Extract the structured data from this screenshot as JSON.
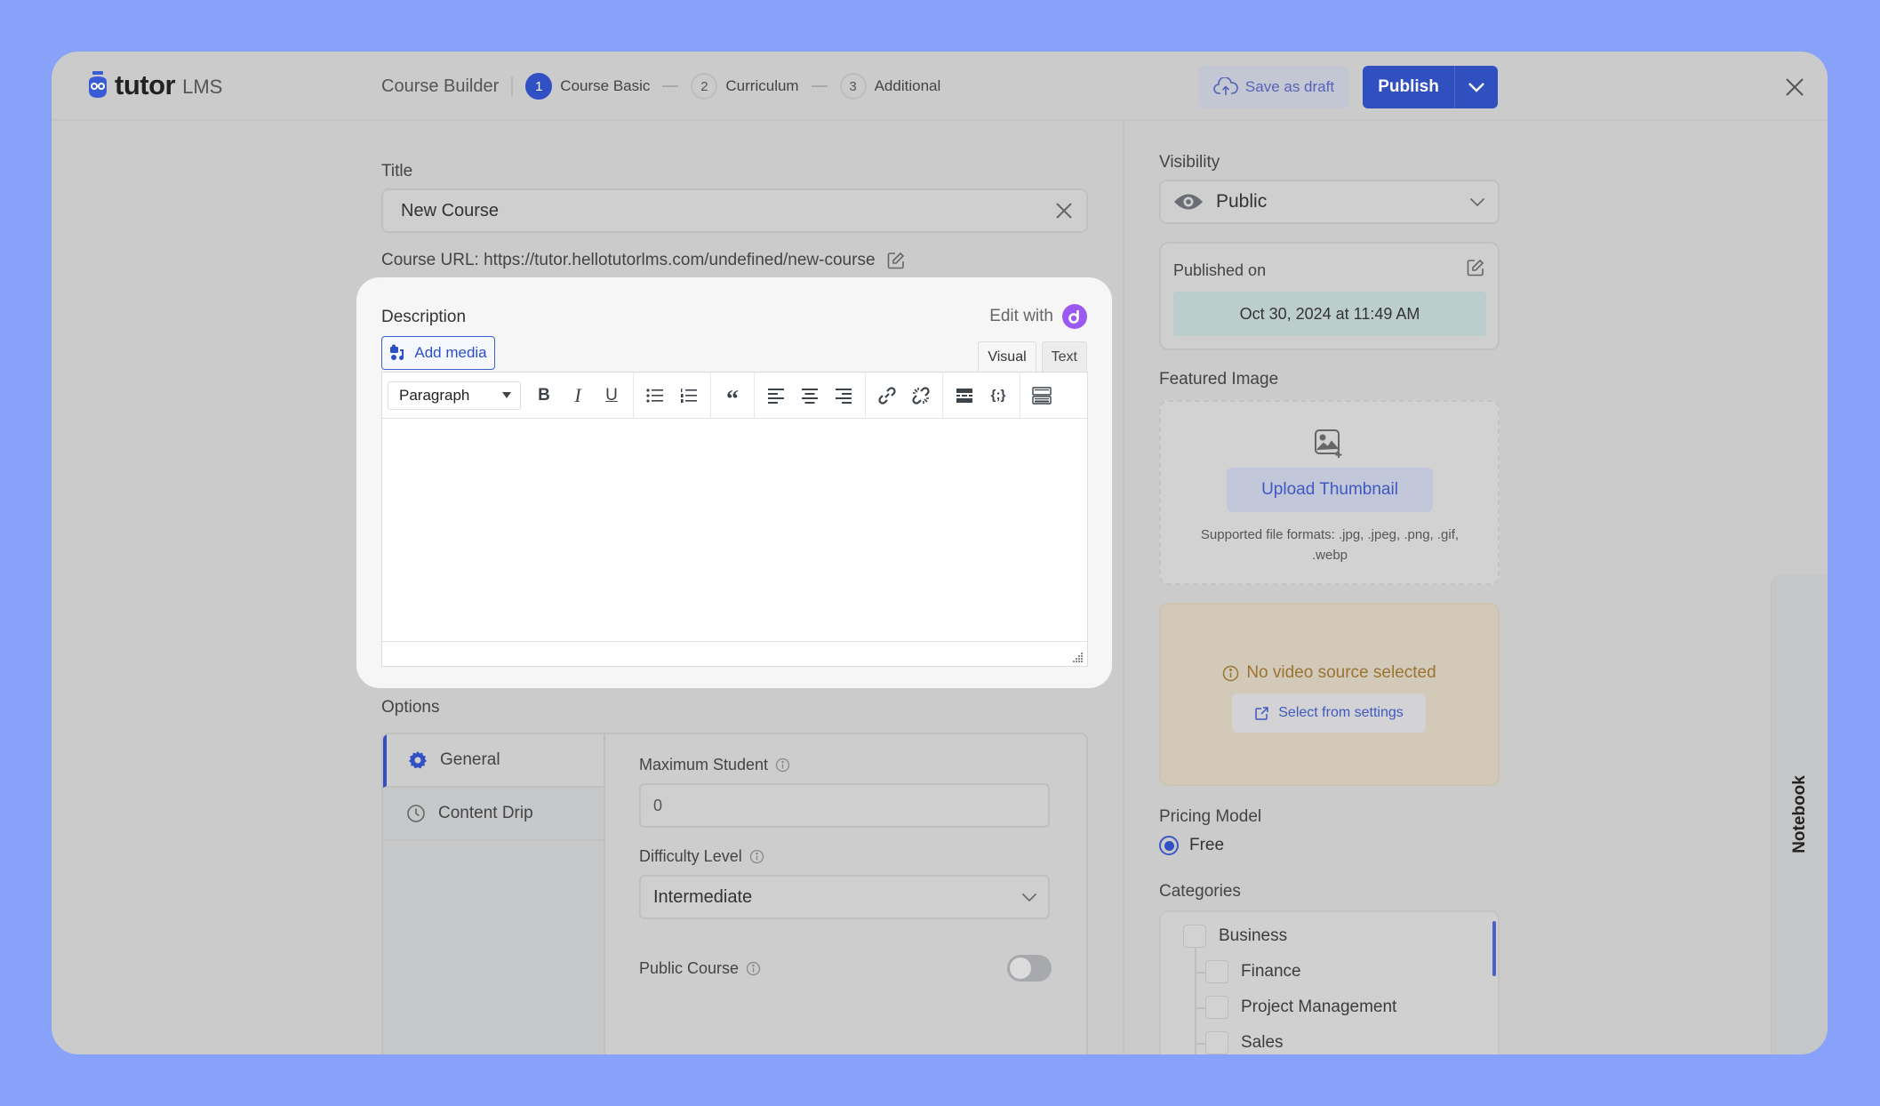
{
  "header": {
    "logo_word": "tutor",
    "logo_suffix": "LMS",
    "builder_title": "Course Builder",
    "steps": [
      {
        "num": "1",
        "label": "Course Basic",
        "active": true
      },
      {
        "num": "2",
        "label": "Curriculum",
        "active": false
      },
      {
        "num": "3",
        "label": "Additional",
        "active": false
      }
    ],
    "save_draft_label": "Save as draft",
    "publish_label": "Publish"
  },
  "main": {
    "title_label": "Title",
    "title_value": "New Course",
    "course_url_label": "Course URL:",
    "course_url_value": "https://tutor.hellotutorlms.com/undefined/new-course",
    "description": {
      "label": "Description",
      "edit_with_label": "Edit with",
      "add_media_label": "Add media",
      "mode_tabs": [
        "Visual",
        "Text"
      ],
      "format_select": "Paragraph",
      "content": ""
    },
    "options": {
      "label": "Options",
      "tabs": [
        {
          "label": "General",
          "active": true
        },
        {
          "label": "Content Drip",
          "active": false
        }
      ],
      "max_student_label": "Maximum Student",
      "max_student_value": "0",
      "difficulty_label": "Difficulty Level",
      "difficulty_value": "Intermediate",
      "public_course_label": "Public Course",
      "public_course_enabled": false
    }
  },
  "sidebar": {
    "visibility_label": "Visibility",
    "visibility_value": "Public",
    "published_on_label": "Published on",
    "published_on_value": "Oct 30, 2024 at 11:49 AM",
    "featured_image_label": "Featured Image",
    "upload_thumbnail_label": "Upload Thumbnail",
    "supported_formats": "Supported file formats: .jpg, .jpeg, .png, .gif, .webp",
    "video_message": "No video source selected",
    "select_from_settings_label": "Select from settings",
    "pricing_model_label": "Pricing Model",
    "pricing_option": "Free",
    "categories_label": "Categories",
    "categories": [
      {
        "label": "Business",
        "level": 0,
        "checked": false
      },
      {
        "label": "Finance",
        "level": 1,
        "checked": false
      },
      {
        "label": "Project Management",
        "level": 1,
        "checked": false
      },
      {
        "label": "Sales",
        "level": 1,
        "checked": false
      }
    ]
  },
  "notebook_label": "Notebook",
  "colors": {
    "primary": "#3050c4",
    "background": "#87a2f8",
    "warning_text": "#9a7431",
    "edit_with_brand": "#9b59f0"
  }
}
